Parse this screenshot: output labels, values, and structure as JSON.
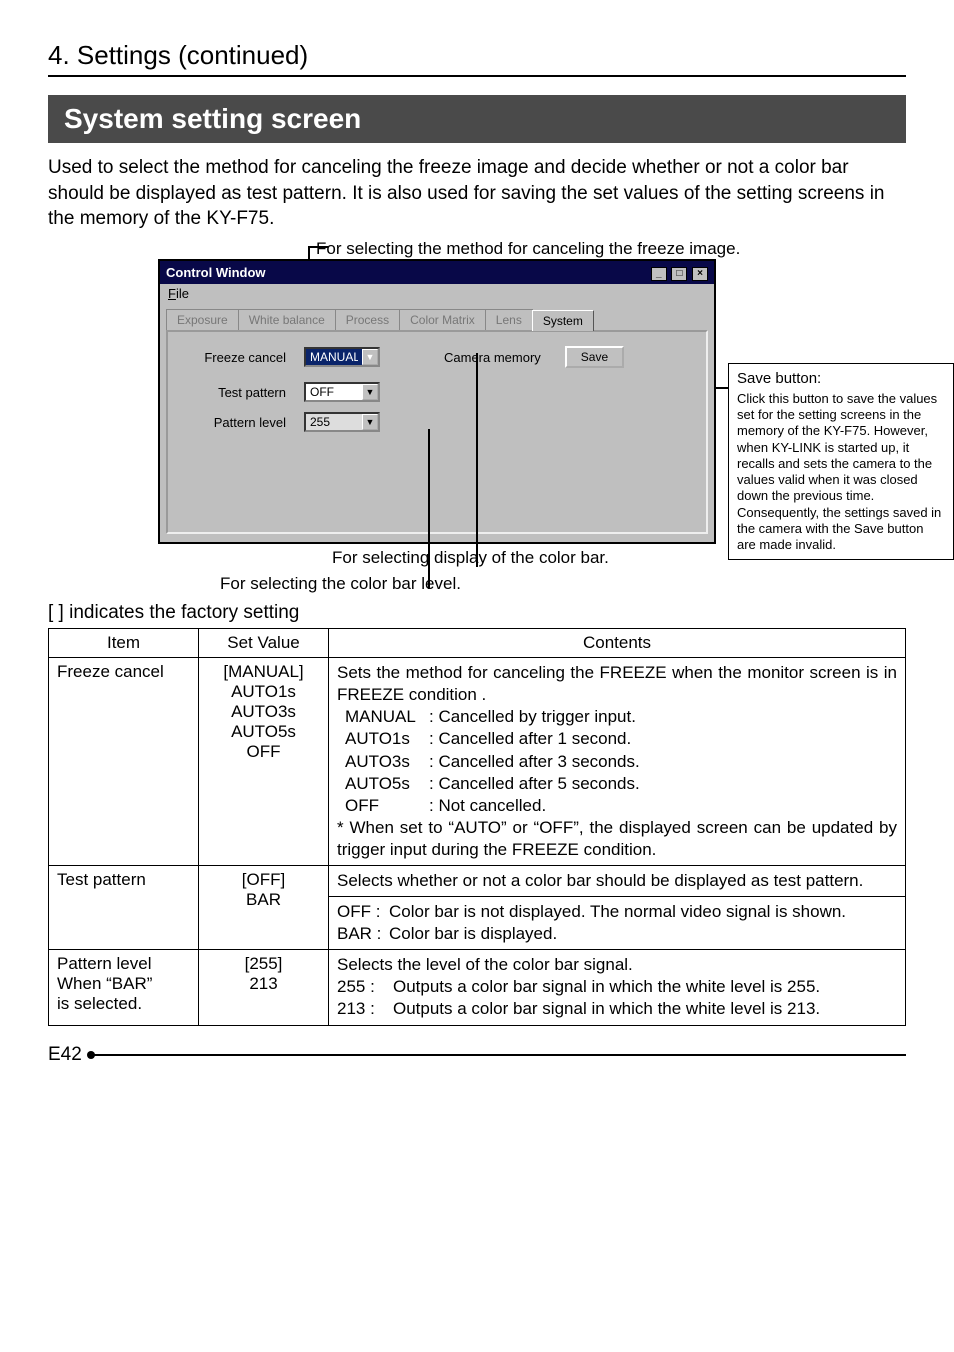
{
  "section_header": "4. Settings (continued)",
  "banner": "System setting screen",
  "intro": "Used to select the method for canceling the freeze image and decide whether or not a color bar should be displayed as test pattern. It is also used for saving the set values of the setting screens in the memory of the KY-F75.",
  "caption_top": "For selecting the method for canceling the freeze image.",
  "window": {
    "title": "Control Window",
    "menu_file": "File",
    "tabs": [
      "Exposure",
      "White balance",
      "Process",
      "Color Matrix",
      "Lens",
      "System"
    ],
    "freeze_cancel_label": "Freeze cancel",
    "freeze_cancel_value": "MANUAL",
    "camera_memory_label": "Camera memory",
    "save_btn": "Save",
    "test_pattern_label": "Test pattern",
    "test_pattern_value": "OFF",
    "pattern_level_label": "Pattern level",
    "pattern_level_value": "255"
  },
  "callout": {
    "title": "Save button:",
    "body": "Click this button to save the values set for the setting screens in the memory of the KY-F75. However, when KY-LINK is started up, it recalls and sets the camera to the values valid when it was closed down the previous time. Consequently, the settings saved in the camera with the Save button are made invalid."
  },
  "caption_colorbar": "For selecting display of the color bar.",
  "caption_level": "For selecting the color bar level.",
  "factory_note": "[  ] indicates the factory setting",
  "table": {
    "head": {
      "item": "Item",
      "set": "Set Value",
      "contents": "Contents"
    },
    "rows": [
      {
        "item": "Freeze cancel",
        "set": "[MANUAL]\nAUTO1s\nAUTO3s\nAUTO5s\nOFF",
        "contents_intro": "Sets the method for canceling the FREEZE when the monitor screen is in FREEZE condition .",
        "opts": [
          {
            "k": "MANUAL",
            "v": "Cancelled by trigger input."
          },
          {
            "k": "AUTO1s",
            "v": "Cancelled after 1 second."
          },
          {
            "k": "AUTO3s",
            "v": "Cancelled after 3 seconds."
          },
          {
            "k": "AUTO5s",
            "v": "Cancelled after 5 seconds."
          },
          {
            "k": "OFF",
            "v": "Not cancelled."
          }
        ],
        "note": "*  When set to “AUTO” or “OFF”, the displayed screen can be updated by trigger input during the FREEZE condition."
      },
      {
        "item": "Test pattern",
        "set": "[OFF]\nBAR",
        "contents_intro": "Selects whether or not a color bar should be displayed as test pattern.",
        "opts2": [
          {
            "k": "OFF :",
            "v": "Color bar is not displayed. The normal video signal is shown."
          },
          {
            "k": "BAR :",
            "v": "Color bar is displayed."
          }
        ]
      },
      {
        "item": "Pattern level\nWhen “BAR”\nis selected.",
        "set": "[255]\n213",
        "contents_intro": "Selects the level of the color bar signal.",
        "opts3": [
          {
            "k": "255  :",
            "v": "Outputs a color bar signal in which the white level is 255."
          },
          {
            "k": "213  :",
            "v": "Outputs a color bar signal in which the white level is 213."
          }
        ]
      }
    ]
  },
  "page_no": "E42"
}
